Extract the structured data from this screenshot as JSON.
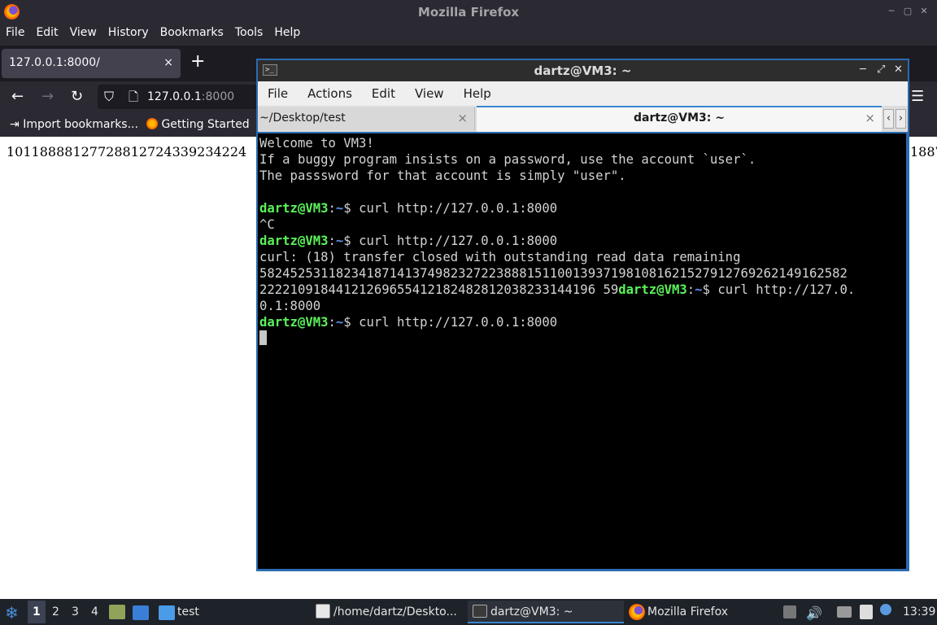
{
  "firefox": {
    "window_title": "Mozilla Firefox",
    "menu": [
      "File",
      "Edit",
      "View",
      "History",
      "Bookmarks",
      "Tools",
      "Help"
    ],
    "tab_label": "127.0.0.1:8000/",
    "tab_close": "×",
    "new_tab": "+",
    "url_host": "127.0.0.1",
    "url_port": ":8000",
    "bookmarks": [
      "Import bookmarks...",
      "Getting Started"
    ],
    "page_text_left": "10118888127728812724339234224",
    "page_text_right": "1887"
  },
  "terminal": {
    "window_title": "dartz@VM3: ~",
    "title_icon": ">_",
    "menu": [
      "File",
      "Actions",
      "Edit",
      "View",
      "Help"
    ],
    "tabs": [
      {
        "label": "~/Desktop/test",
        "close": "×"
      },
      {
        "label": "dartz@VM3: ~",
        "close": "×"
      }
    ],
    "prompt_user": "dartz@VM3",
    "prompt_colon": ":",
    "prompt_path": "~",
    "prompt_dollar": "$ ",
    "lines": {
      "l1": "Welcome to VM3!",
      "l2": "If a buggy program insists on a password, use the account `user`.",
      "l3": "The passsword for that account is simply \"user\".",
      "cmd1": "curl http://127.0.0.1:8000",
      "l5": "^C",
      "cmd2": "curl http://127.0.0.1:8000",
      "l7": "curl: (18) transfer closed with outstanding read data remaining",
      "l8": "5824525311823418714137498232722388815110013937198108162152791276926214916258​2",
      "l9_out": "22221091844121269655412182482812038233144196 59",
      "cmd3": "curl http://127.0.",
      "l10": "0.1:8000",
      "cmd4": "curl http://127.0.0.1:8000"
    }
  },
  "taskbar": {
    "workspaces": [
      "1",
      "2",
      "3",
      "4"
    ],
    "folder_label": "test",
    "tasks": [
      "/home/dartz/Deskto...",
      "dartz@VM3: ~",
      "Mozilla Firefox"
    ],
    "clock": "13:39"
  }
}
